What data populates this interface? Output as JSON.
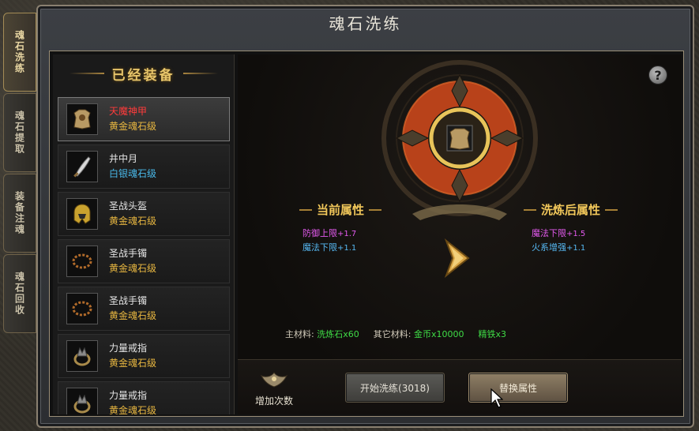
{
  "window": {
    "title": "魂石洗练"
  },
  "side_tabs": [
    {
      "label": "魂石洗练",
      "active": true
    },
    {
      "label": "魂石提取",
      "active": false
    },
    {
      "label": "装备注魂",
      "active": false
    },
    {
      "label": "魂石回收",
      "active": false
    }
  ],
  "equipped": {
    "title": "已经装备",
    "items": [
      {
        "name": "天魔神甲",
        "grade": "黄金魂石级",
        "icon": "armor-icon",
        "name_color": "#ff3b3b"
      },
      {
        "name": "井中月",
        "grade": "白银魂石级",
        "icon": "sword-icon"
      },
      {
        "name": "圣战头盔",
        "grade": "黄金魂石级",
        "icon": "helmet-icon"
      },
      {
        "name": "圣战手镯",
        "grade": "黄金魂石级",
        "icon": "bracelet-icon"
      },
      {
        "name": "圣战手镯",
        "grade": "黄金魂石级",
        "icon": "bracelet-icon"
      },
      {
        "name": "力量戒指",
        "grade": "黄金魂石级",
        "icon": "ring-icon"
      },
      {
        "name": "力量戒指",
        "grade": "黄金魂石级",
        "icon": "ring-icon"
      }
    ]
  },
  "current_attrs": {
    "title": "当前属性",
    "rows": [
      {
        "name": "防御上限",
        "value": "+1.7",
        "color": "#e35aee"
      },
      {
        "name": "魔法下限",
        "value": "+1.1",
        "color": "#56b8f2"
      }
    ]
  },
  "after_attrs": {
    "title": "洗炼后属性",
    "rows": [
      {
        "name": "魔法下限",
        "value": "+1.5",
        "color": "#e35aee"
      },
      {
        "name": "火系增强",
        "value": "+1.1",
        "color": "#56b8f2"
      }
    ]
  },
  "materials": {
    "main_label": "主材料:",
    "main_value": "洗炼石x60",
    "other_label": "其它材料:",
    "other_value_1": "金币x10000",
    "other_value_2": "精铁x3"
  },
  "actions": {
    "add_count": "增加次数",
    "start": "开始洗练(3018)",
    "replace": "替换属性"
  },
  "help": "?"
}
